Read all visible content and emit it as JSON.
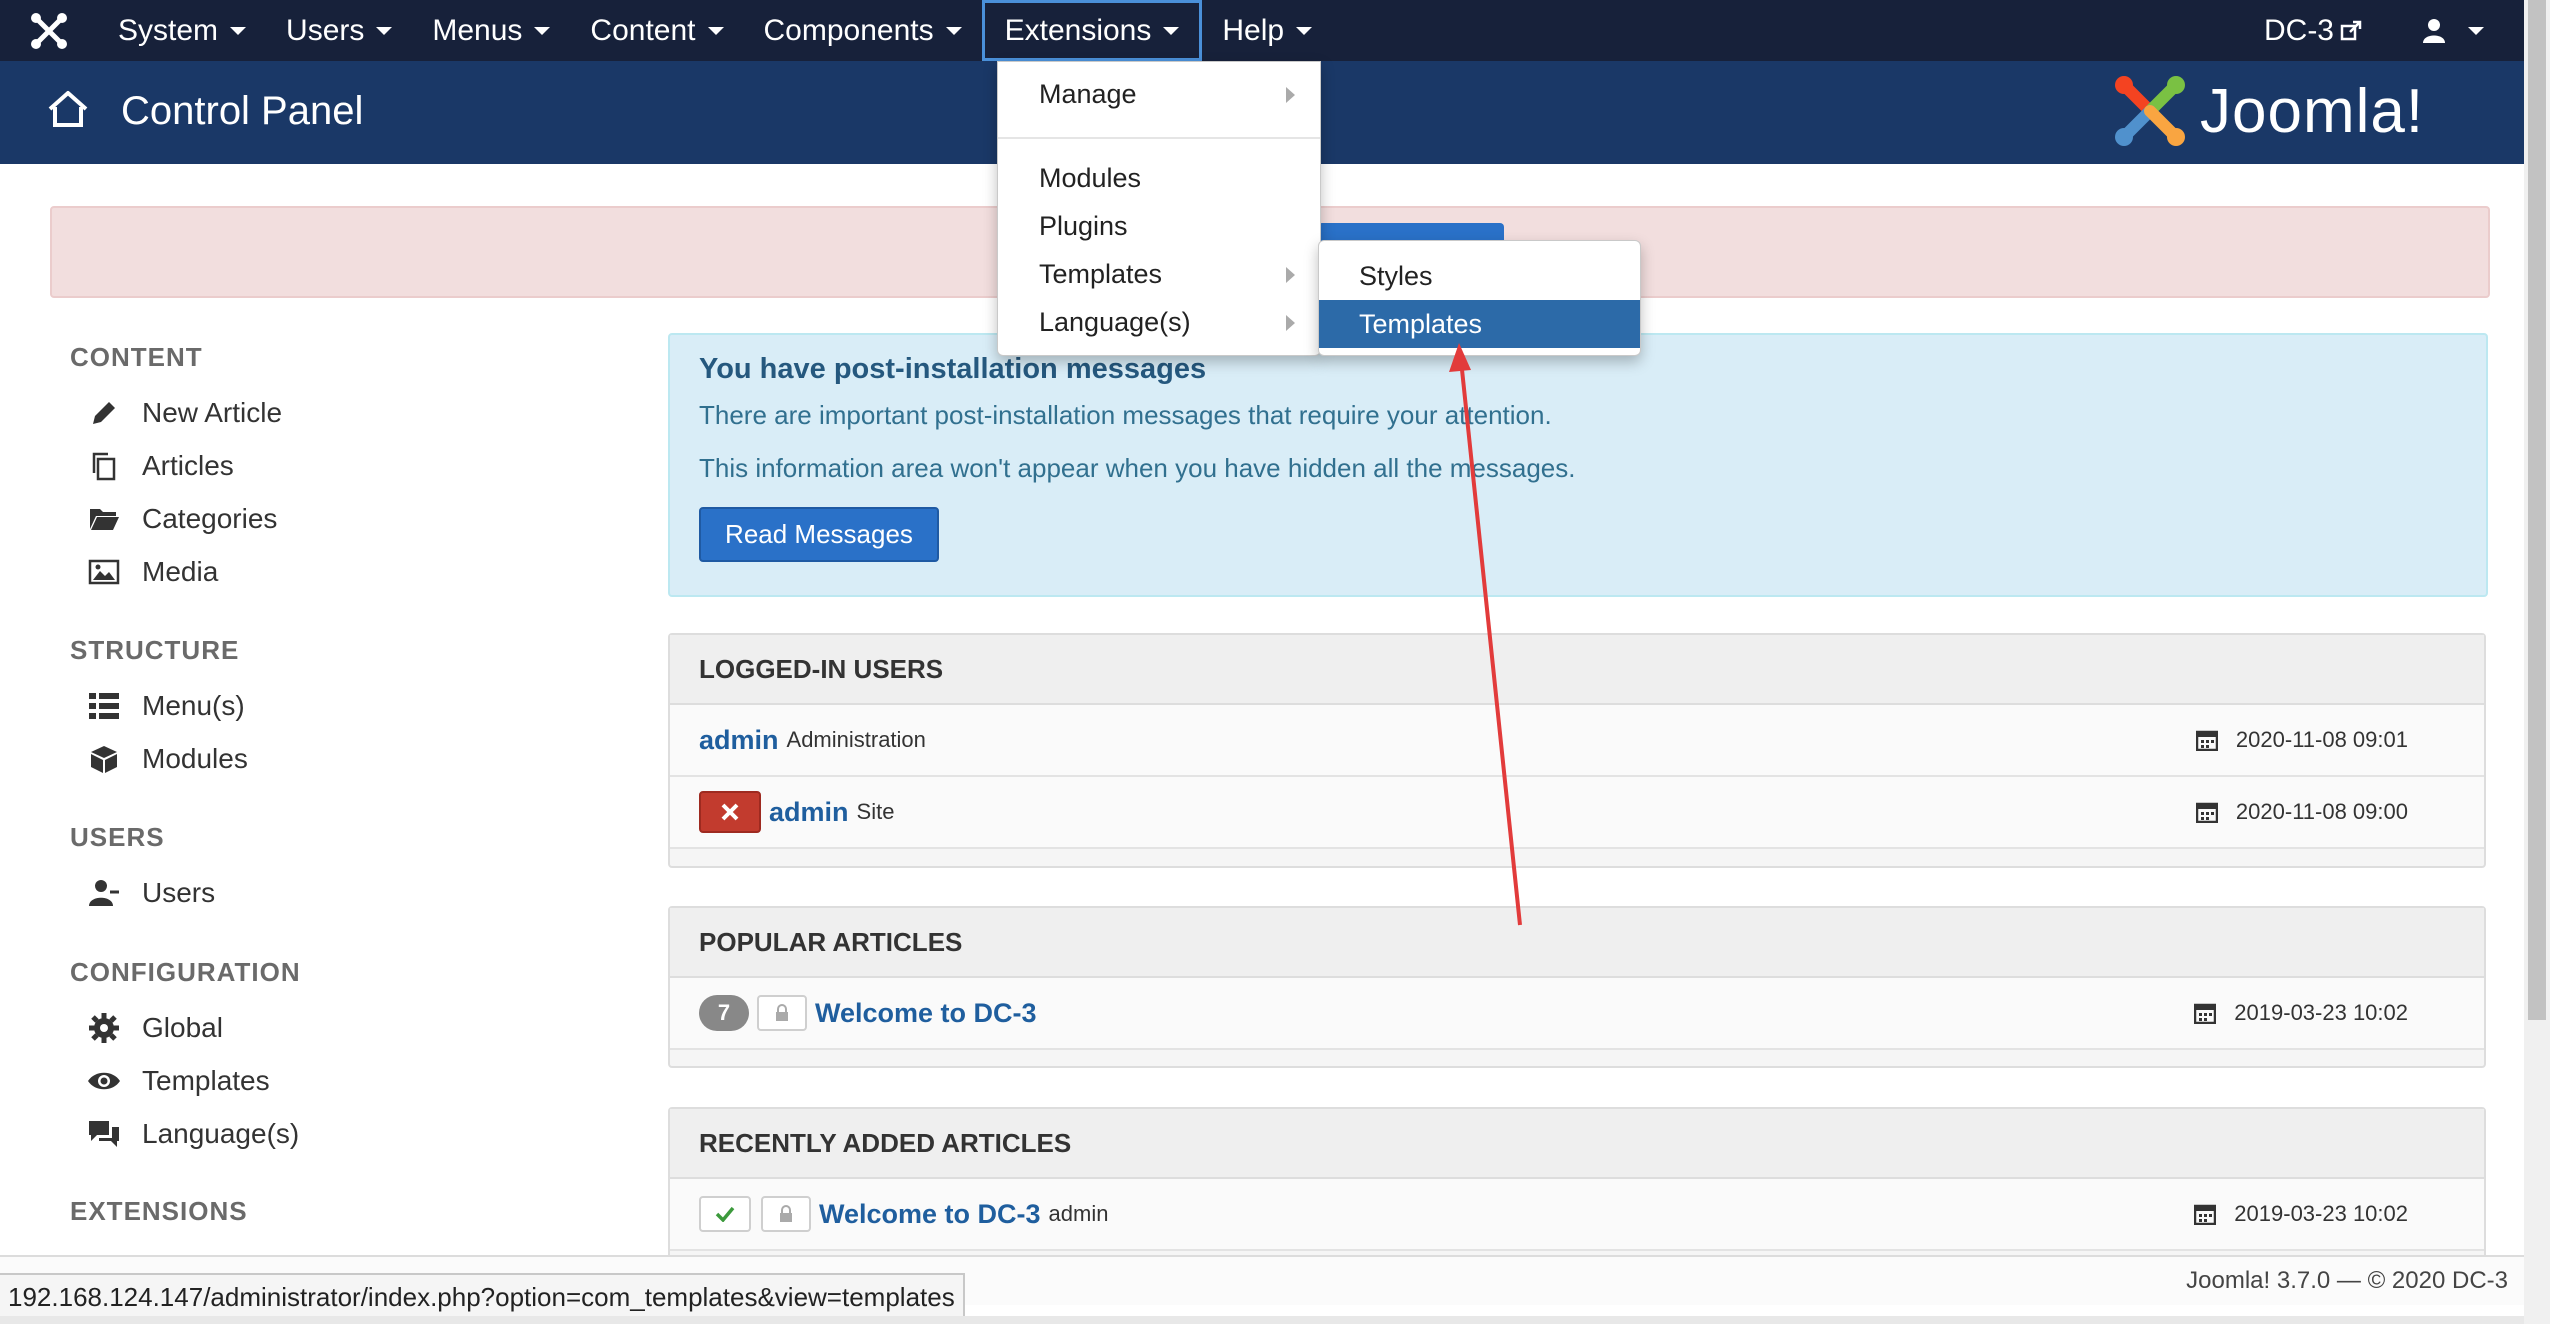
{
  "nav": {
    "items": [
      {
        "label": "System"
      },
      {
        "label": "Users"
      },
      {
        "label": "Menus"
      },
      {
        "label": "Content"
      },
      {
        "label": "Components"
      },
      {
        "label": "Extensions"
      },
      {
        "label": "Help"
      }
    ],
    "site_link": "DC-3"
  },
  "header": {
    "title": "Control Panel",
    "logo_text": "Joomla!"
  },
  "dropdown": {
    "manage": "Manage",
    "modules": "Modules",
    "plugins": "Plugins",
    "templates": "Templates",
    "languages": "Language(s)"
  },
  "submenu": {
    "styles": "Styles",
    "templates": "Templates"
  },
  "sidebar": {
    "content_heading": "CONTENT",
    "new_article": "New Article",
    "articles": "Articles",
    "categories": "Categories",
    "media": "Media",
    "structure_heading": "STRUCTURE",
    "menus": "Menu(s)",
    "modules": "Modules",
    "users_heading": "USERS",
    "users": "Users",
    "config_heading": "CONFIGURATION",
    "global": "Global",
    "templates": "Templates",
    "languages": "Language(s)",
    "extensions_heading": "EXTENSIONS"
  },
  "info": {
    "heading": "You have post-installation messages",
    "line1": "There are important post-installation messages that require your attention.",
    "line2": "This information area won't appear when you have hidden all the messages.",
    "button": "Read Messages"
  },
  "logged_in": {
    "heading": "LOGGED-IN USERS",
    "rows": [
      {
        "name": "admin",
        "area": "Administration",
        "time": "2020-11-08 09:01"
      },
      {
        "name": "admin",
        "area": "Site",
        "time": "2020-11-08 09:00"
      }
    ]
  },
  "popular": {
    "heading": "POPULAR ARTICLES",
    "rows": [
      {
        "hits": "7",
        "title": "Welcome to DC-3",
        "time": "2019-03-23 10:02"
      }
    ]
  },
  "recent": {
    "heading": "RECENTLY ADDED ARTICLES",
    "rows": [
      {
        "title": "Welcome to DC-3",
        "author": "admin",
        "time": "2019-03-23 10:02"
      }
    ]
  },
  "footer": {
    "text": "Joomla! 3.7.0  —  © 2020 DC-3"
  },
  "status_url": "192.168.124.147/administrator/index.php?option=com_templates&view=templates",
  "colors": {
    "navbar": "#17213a",
    "header": "#1a3867",
    "highlight": "#2c6aa8",
    "annotation_arrow": "#e23b3b"
  }
}
